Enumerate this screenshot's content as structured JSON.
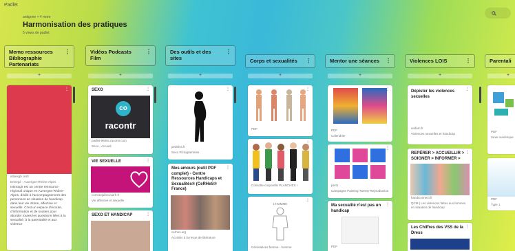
{
  "app": {
    "brand": "Padlet",
    "breadcrumb": "antigone + 4 more",
    "title": "Harmonisation des pratiques",
    "subtitle": "5 views de padlet",
    "search_icon": "search-icon"
  },
  "columns": [
    {
      "title": "Memo ressources\nBibliographie\nPartenariats",
      "cards": [
        {
          "title": "",
          "caption": "inbiesgh orsfr",
          "caption2": "Entregé - Auvergne-Rhône-Alpes",
          "text": "Intimagir est un centre ressource régional unique en Auvergne-Rhône-Alpes, dédié à l'accompagnement des personnes en situation de handicap dans leur vie intime, affective et sexuelle. C'est un espace d'écoute, d'information et de soutien pour aborder toutes les questions liées à la sexualité, à la parentalité et aux violence"
        }
      ]
    },
    {
      "title": "Vidéos Podcasts\nFilm",
      "cards": [
        {
          "title": "SEXO",
          "logo": "co",
          "logo_text": "racontr",
          "caption": "padlet-9606c.racontr.com",
          "caption2": "Sexo - Accueil"
        },
        {
          "title": "VIE SEXUELLE",
          "caption": "comsequilecuvarh.fr",
          "caption2": "Vie affective et sexuelle"
        },
        {
          "title": "SEXO ET HANDICAP"
        }
      ]
    },
    {
      "title": "Des outils et des\nsites",
      "cards": [
        {
          "title": "",
          "caption": "pedelos.fr",
          "caption2": "Sexo Pictogrammes"
        },
        {
          "title": "Mes amours (outil PDF complet) - Centre Ressources Handicaps et Sexualités® (CeRHeS® France)",
          "caption": "cerhes.org",
          "caption2": "Accéder à la revue de littérature"
        }
      ]
    },
    {
      "title": "Corps  et sexualités",
      "cards": [
        {
          "title": "",
          "caption": "PDF"
        },
        {
          "title": "",
          "caption": "Consolte-corporelle PLANCHES I"
        },
        {
          "title": "",
          "caption": "L'HOMME",
          "caption2": "Générations femme - homme"
        }
      ]
    },
    {
      "title": "Mentor une séances",
      "cards": [
        {
          "title": "",
          "caption": "PDF",
          "caption2": "Calendrier"
        },
        {
          "title": "",
          "caption": "perto",
          "caption2": "Campagne Painting Twenty-Reproduction"
        },
        {
          "title": "Ma sexualité n'est pas un handicap",
          "caption": "PDF"
        }
      ]
    },
    {
      "title": "Violences LOIS",
      "cards": [
        {
          "title": "Dépister les violences sexuelles",
          "caption": "unifam.fr",
          "caption2": "Violences sexuelles et handicap"
        },
        {
          "title": "REPÉRER > ACCUEILLIR > SOIGNER > INFORMER >",
          "caption": "handiconnect.fr",
          "caption2": "QCM | Les violences faites aux femmes en situation de handicap"
        },
        {
          "title": "Les Chiffres des VSS de la Dress"
        }
      ]
    },
    {
      "title": "Parentali",
      "cards": [
        {
          "title": "",
          "caption": "PDF",
          "caption2": "Sexe numérique"
        },
        {
          "title": "",
          "caption": "PDF",
          "caption2": "Type 1"
        }
      ]
    }
  ],
  "colors": {
    "accent": "#3fc3d2",
    "card_bg": "#ffffff"
  }
}
